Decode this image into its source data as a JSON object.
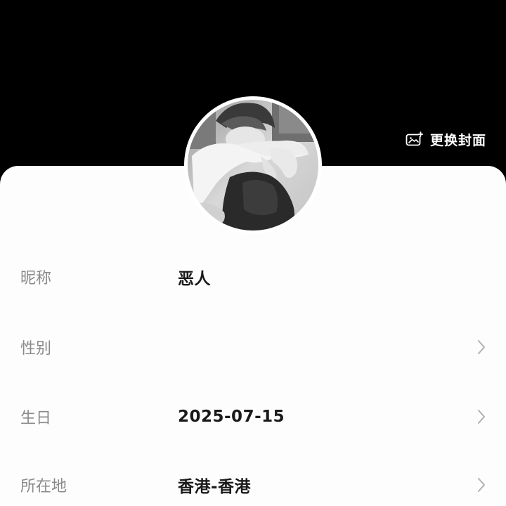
{
  "header": {
    "change_cover_label": "更换封面",
    "change_cover_icon": "image-add-icon"
  },
  "profile": {
    "avatar_icon": "avatar-photo",
    "fields": [
      {
        "key": "昵称",
        "value": "恶人",
        "has_chevron": false
      },
      {
        "key": "性别",
        "value": "",
        "has_chevron": true
      },
      {
        "key": "生日",
        "value": "2025-07-15",
        "has_chevron": true
      },
      {
        "key": "所在地",
        "value": "香港-香港",
        "has_chevron": true
      }
    ]
  },
  "colors": {
    "header_bg": "#000000",
    "sheet_bg": "#fdfdfd",
    "label_gray": "#8a8a8a",
    "value_dark": "#1a1a1a",
    "chevron_gray": "#b0b0b0"
  }
}
